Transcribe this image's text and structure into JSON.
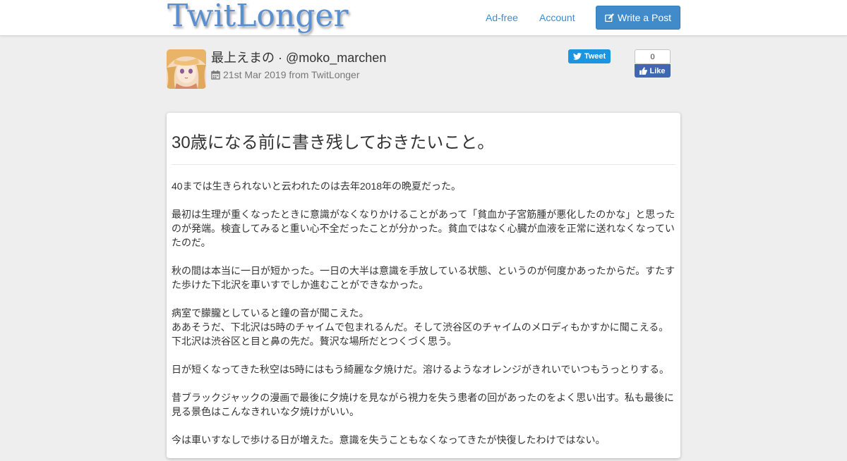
{
  "nav": {
    "logo": "TwitLonger",
    "links": [
      "Ad-free",
      "Account"
    ],
    "write_button": "Write a Post"
  },
  "post_meta": {
    "author": "最上えまの · @moko_marchen",
    "date": "21st Mar 2019 from TwitLonger",
    "tweet_label": "Tweet",
    "like_count": "0",
    "like_label": "Like"
  },
  "post": {
    "title": "30歳になる前に書き残しておきたいこと。",
    "paragraphs": [
      [
        "40までは生きられないと云われたのは去年2018年の晩夏だった。"
      ],
      [
        "最初は生理が重くなったときに意識がなくなりかけることがあって「貧血か子宮筋腫が悪化したのかな」と思ったのが発端。検査してみると重い心不全だったことが分かった。貧血ではなく心臓が血液を正常に送れなくなっていたのだ。"
      ],
      [
        "秋の間は本当に一日が短かった。一日の大半は意識を手放している状態、というのが何度かあったからだ。すたすた歩けた下北沢を車いすでしか進むことができなかった。"
      ],
      [
        "病室で朦朧としていると鐘の音が聞こえた。",
        "ああそうだ、下北沢は5時のチャイムで包まれるんだ。そして渋谷区のチャイムのメロディもかすかに聞こえる。",
        "下北沢は渋谷区と目と鼻の先だ。贅沢な場所だとつくづく思う。"
      ],
      [
        "日が短くなってきた秋空は5時にはもう綺麗な夕焼けだ。溶けるようなオレンジがきれいでいつもうっとりする。"
      ],
      [
        "昔ブラックジャックの漫画で最後に夕焼けを見ながら視力を失う患者の回があったのをよく思い出す。私も最後に見る景色はこんなきれいな夕焼けがいい。"
      ],
      [
        "今は車いすなしで歩ける日が増えた。意識を失うこともなくなってきたが快復したわけではない。"
      ]
    ]
  },
  "colors": {
    "accent": "#428bca",
    "twitter": "#1b95e0",
    "facebook": "#4267b2",
    "background": "#eeeeee"
  },
  "icons": [
    "edit-icon",
    "calendar-icon",
    "twitter-bird-icon",
    "thumbs-up-icon"
  ]
}
